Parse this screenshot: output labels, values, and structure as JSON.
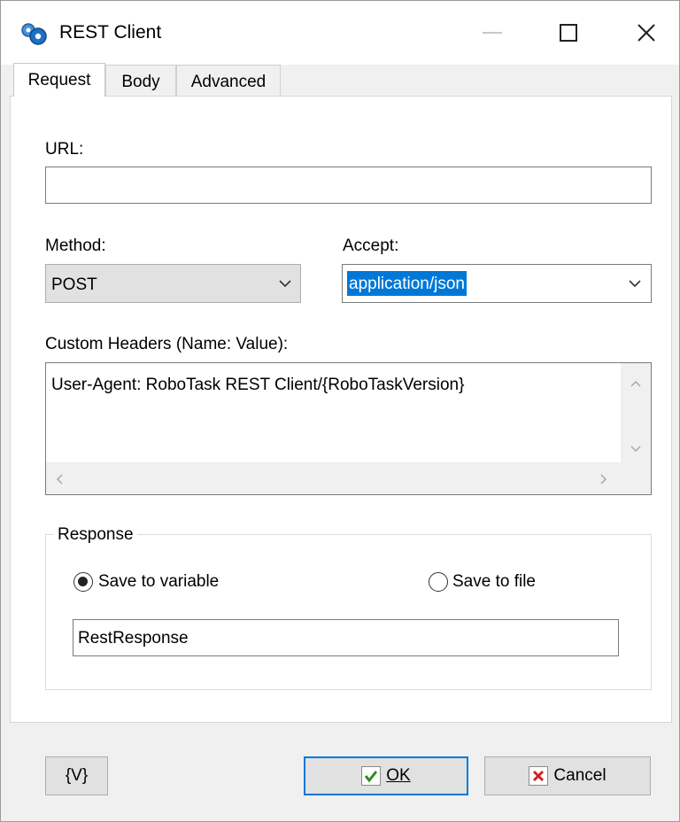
{
  "window": {
    "title": "REST Client"
  },
  "tabs": [
    {
      "label": "Request",
      "active": true
    },
    {
      "label": "Body",
      "active": false
    },
    {
      "label": "Advanced",
      "active": false
    }
  ],
  "request": {
    "url_label": "URL:",
    "url_value": "",
    "method_label": "Method:",
    "method_value": "POST",
    "accept_label": "Accept:",
    "accept_value": "application/json",
    "headers_label": "Custom Headers (Name: Value):",
    "headers_value": "User-Agent: RoboTask REST Client/{RoboTaskVersion}"
  },
  "response": {
    "group_label": "Response",
    "option_variable": "Save to variable",
    "option_file": "Save to file",
    "selected": "variable",
    "variable_value": "RestResponse"
  },
  "buttons": {
    "variables": "{V}",
    "ok": "OK",
    "cancel": "Cancel"
  },
  "icons": {
    "app": "robotask-gears-icon",
    "ok": "check-icon",
    "cancel": "x-icon"
  },
  "colors": {
    "selection": "#0078d7",
    "default_button_border": "#0078d7",
    "ok_check": "#2e8b1e",
    "cancel_x": "#d32020"
  }
}
